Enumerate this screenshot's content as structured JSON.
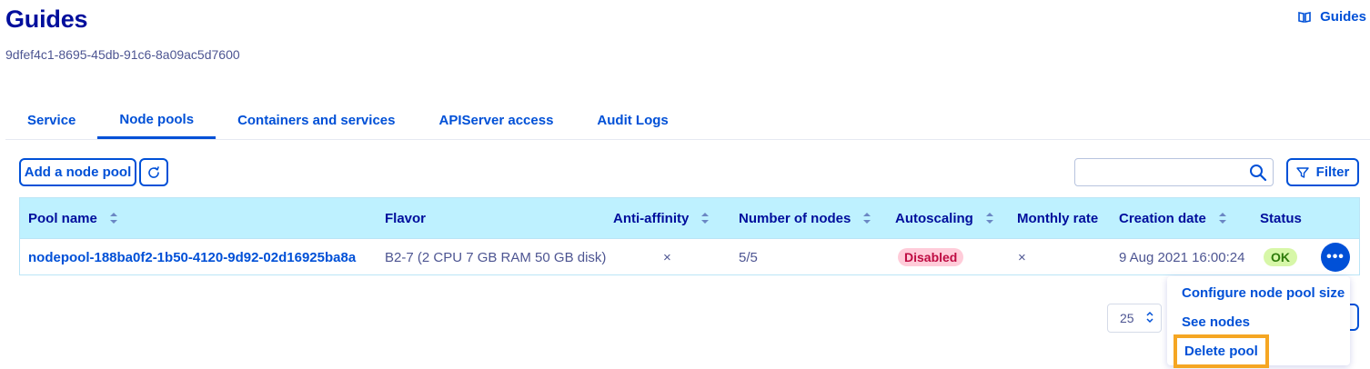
{
  "header": {
    "title": "Guides",
    "subtitle": "9dfef4c1-8695-45db-91c6-8a09ac5d7600",
    "guides_link": "Guides",
    "guides_icon": "book-icon"
  },
  "tabs": [
    {
      "label": "Service",
      "active": false
    },
    {
      "label": "Node pools",
      "active": true
    },
    {
      "label": "Containers and services",
      "active": false
    },
    {
      "label": "APIServer access",
      "active": false
    },
    {
      "label": "Audit Logs",
      "active": false
    }
  ],
  "toolbar": {
    "add_label": "Add a node pool",
    "refresh_icon": "refresh-icon",
    "search_value": "",
    "search_icon": "search-icon",
    "filter_label": "Filter",
    "filter_icon": "funnel-icon"
  },
  "table": {
    "columns": [
      "Pool name",
      "Flavor",
      "Anti-affinity",
      "Number of nodes",
      "Autoscaling",
      "Monthly rate",
      "Creation date",
      "Status"
    ],
    "rows": [
      {
        "pool_name": "nodepool-188ba0f2-1b50-4120-9d92-02d16925ba8a",
        "flavor": "B2-7 (2 CPU 7 GB RAM 50 GB disk)",
        "anti_affinity": "×",
        "number_of_nodes": "5/5",
        "autoscaling": "Disabled",
        "monthly_rate": "×",
        "creation_date": "9 Aug 2021 16:00:24",
        "status": "OK",
        "actions_label": "•••"
      }
    ]
  },
  "menu": {
    "items": [
      "Configure node pool size",
      "See nodes",
      "Delete pool"
    ]
  },
  "pager": {
    "page_size": "25"
  },
  "colors": {
    "brand": "#0050d7",
    "title": "#000e9c",
    "header_bg": "#bef1ff",
    "highlight": "#f5a623"
  }
}
